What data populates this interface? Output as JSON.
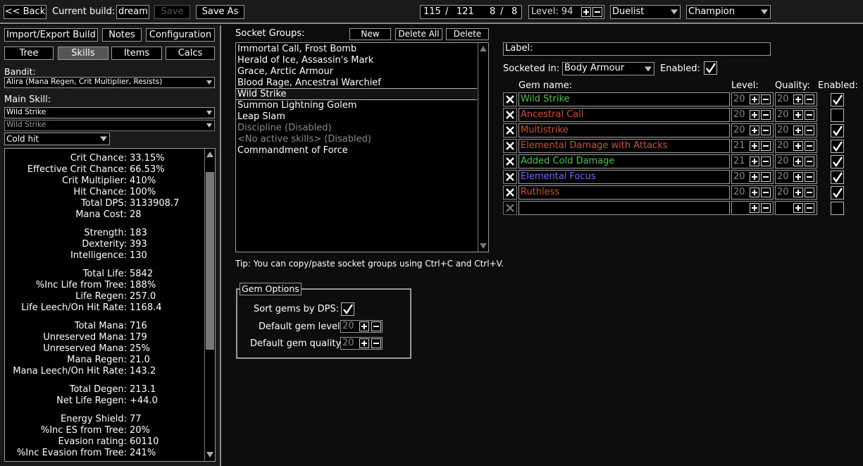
{
  "topbar": {
    "back_label": "<< Back",
    "current_build_label": "Current build:",
    "build_name": "dream",
    "save_label": "Save",
    "save_as_label": "Save As",
    "points_used": "115",
    "points_total": "121",
    "asc_used": "8",
    "asc_total": "8",
    "points_sep": "/",
    "level_text": "Level: 94",
    "class_name": "Duelist",
    "ascendancy_name": "Champion"
  },
  "left": {
    "import_export_label": "Import/Export Build",
    "notes_label": "Notes",
    "configuration_label": "Configuration",
    "tabs": [
      {
        "label": "Tree"
      },
      {
        "label": "Skills"
      },
      {
        "label": "Items"
      },
      {
        "label": "Calcs"
      }
    ],
    "bandit_label": "Bandit:",
    "bandit_value": "Alira (Mana Regen, Crit Multiplier, Resists)",
    "main_skill_label": "Main Skill:",
    "main_skill_value": "Wild Strike",
    "sub_skill_value": "Wild Strike",
    "skill_part_value": "Cold hit",
    "stats": [
      {
        "k": "Crit Chance:",
        "v": "33.15%"
      },
      {
        "k": "Effective Crit Chance:",
        "v": "66.53%"
      },
      {
        "k": "Crit Multiplier:",
        "v": "410%"
      },
      {
        "k": "Hit Chance:",
        "v": "100%"
      },
      {
        "k": "Total DPS:",
        "v": "3133908.7"
      },
      {
        "k": "Mana Cost:",
        "v": "28"
      },
      {
        "k": "Strength:",
        "v": "183"
      },
      {
        "k": "Dexterity:",
        "v": "393"
      },
      {
        "k": "Intelligence:",
        "v": "130"
      },
      {
        "k": "Total Life:",
        "v": "5842"
      },
      {
        "k": "%Inc Life from Tree:",
        "v": "188%"
      },
      {
        "k": "Life Regen:",
        "v": "257.0"
      },
      {
        "k": "Life Leech/On Hit Rate:",
        "v": "1168.4"
      },
      {
        "k": "Total Mana:",
        "v": "716"
      },
      {
        "k": "Unreserved Mana:",
        "v": "179"
      },
      {
        "k": "Unreserved Mana:",
        "v": "25%"
      },
      {
        "k": "Mana Regen:",
        "v": "21.0"
      },
      {
        "k": "Mana Leech/On Hit Rate:",
        "v": "143.2"
      },
      {
        "k": "Total Degen:",
        "v": "213.1"
      },
      {
        "k": "Net Life Regen:",
        "v": "+44.0"
      },
      {
        "k": "Energy Shield:",
        "v": "77"
      },
      {
        "k": "%Inc ES from Tree:",
        "v": "20%"
      },
      {
        "k": "Evasion rating:",
        "v": "60110"
      },
      {
        "k": "%Inc Evasion from Tree:",
        "v": "241%"
      }
    ]
  },
  "socket_groups": {
    "title": "Socket Groups:",
    "new_label": "New",
    "delete_all_label": "Delete All",
    "delete_label": "Delete",
    "items": [
      {
        "text": "Immortal Call, Frost Bomb"
      },
      {
        "text": "Herald of Ice, Assassin's Mark"
      },
      {
        "text": "Grace, Arctic Armour"
      },
      {
        "text": "Blood Rage, Ancestral Warchief"
      },
      {
        "text": "Wild Strike"
      },
      {
        "text": "Summon Lightning Golem"
      },
      {
        "text": "Leap Slam"
      },
      {
        "text": "Discipline (Disabled)"
      },
      {
        "text": "<No active skills> (Disabled)"
      },
      {
        "text": "Commandment of Force"
      }
    ],
    "tip": "Tip: You can copy/paste socket groups using Ctrl+C and Ctrl+V."
  },
  "gem_options": {
    "title": "Gem Options",
    "sort_label": "Sort gems by DPS:",
    "default_level_label": "Default gem level:",
    "default_level_value": "20",
    "default_quality_label": "Default gem quality:",
    "default_quality_value": "20"
  },
  "gems": {
    "label_label": "Label:",
    "socketed_in_label": "Socketed in:",
    "socketed_in_value": "Body Armour",
    "enabled_label": "Enabled:",
    "col_name": "Gem name:",
    "col_level": "Level:",
    "col_quality": "Quality:",
    "col_enabled": "Enabled:",
    "rows": [
      {
        "name": "Wild Strike",
        "color": "#4fc24f",
        "level": "20",
        "quality": "20",
        "enabled": true
      },
      {
        "name": "Ancestral Call",
        "color": "#d0503a",
        "level": "20",
        "quality": "20",
        "enabled": false
      },
      {
        "name": "Multistrike",
        "color": "#d0503a",
        "level": "20",
        "quality": "20",
        "enabled": true
      },
      {
        "name": "Elemental Damage with Attacks",
        "color": "#d0503a",
        "level": "21",
        "quality": "20",
        "enabled": true
      },
      {
        "name": "Added Cold Damage",
        "color": "#4fc24f",
        "level": "21",
        "quality": "20",
        "enabled": true
      },
      {
        "name": "Elemental Focus",
        "color": "#6b6bff",
        "level": "20",
        "quality": "20",
        "enabled": true
      },
      {
        "name": "Ruthless",
        "color": "#d0503a",
        "level": "20",
        "quality": "20",
        "enabled": true
      }
    ]
  }
}
